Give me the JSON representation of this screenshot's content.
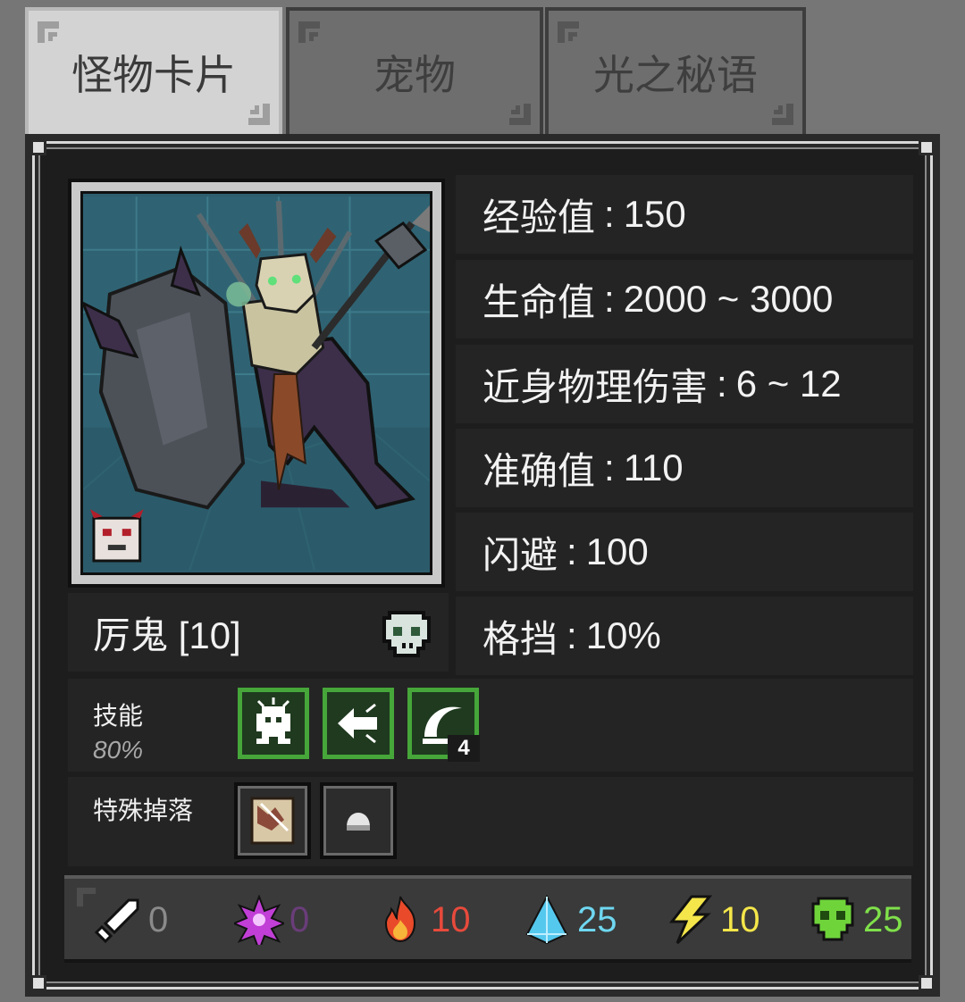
{
  "tabs": [
    {
      "label": "怪物卡片",
      "active": true
    },
    {
      "label": "宠物",
      "active": false
    },
    {
      "label": "光之秘语",
      "active": false
    }
  ],
  "stats": [
    {
      "label": "经验值",
      "value": "150"
    },
    {
      "label": "生命值",
      "value": "2000 ~ 3000"
    },
    {
      "label": "近身物理伤害",
      "value": "6 ~ 12"
    },
    {
      "label": "准确值",
      "value": "110"
    },
    {
      "label": "闪避",
      "value": "100"
    },
    {
      "label": "格挡",
      "value": "10%"
    }
  ],
  "stat_separator": ":",
  "monster": {
    "name": "厉鬼 [10]",
    "portrait": "armored-demon-with-shield-and-spear",
    "corner_icon": "mask-icon",
    "type_icon": "skull-icon"
  },
  "skills": {
    "label": "技能",
    "chance": "80%",
    "items": [
      {
        "icon": "summon-creature-icon"
      },
      {
        "icon": "piercing-arrow-icon"
      },
      {
        "icon": "crescent-slash-icon",
        "count": "4"
      }
    ]
  },
  "drops": {
    "label": "特殊掉落",
    "items": [
      {
        "icon": "card-scroll-icon"
      },
      {
        "icon": "white-stone-icon"
      }
    ]
  },
  "resistances": [
    {
      "icon": "physical-sword-icon",
      "value": "0",
      "color": "#8a8a8a"
    },
    {
      "icon": "arcane-star-icon",
      "value": "0",
      "color": "#6a3d7a"
    },
    {
      "icon": "fire-icon",
      "value": "10",
      "color": "#e84a3c"
    },
    {
      "icon": "ice-crystal-icon",
      "value": "25",
      "color": "#6fd7f0"
    },
    {
      "icon": "lightning-icon",
      "value": "10",
      "color": "#f4e64a"
    },
    {
      "icon": "poison-skull-icon",
      "value": "25",
      "color": "#7fe04a"
    }
  ]
}
